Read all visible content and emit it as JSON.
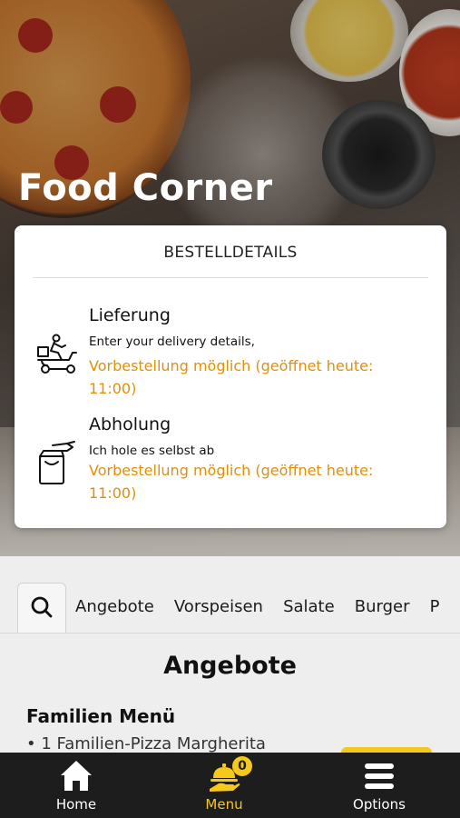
{
  "brand": {
    "title": "Food Corner"
  },
  "order_card": {
    "title": "BESTELLDETAILS",
    "options": [
      {
        "icon": "delivery-scooter-icon",
        "heading": "Lieferung",
        "subtitle": "Enter your delivery details,",
        "note": "Vorbestellung möglich (geöffnet heute: 11:00)"
      },
      {
        "icon": "takeaway-bag-icon",
        "heading": "Abholung",
        "subtitle": "Ich hole es selbst ab",
        "note": "Vorbestellung möglich (geöffnet heute: 11:00)"
      }
    ],
    "note_color": "#e0900a"
  },
  "categories": {
    "search_icon": "search-icon",
    "items": [
      "Angebote",
      "Vorspeisen",
      "Salate",
      "Burger",
      "P"
    ]
  },
  "menu": {
    "section_title": "Angebote",
    "items": [
      {
        "title": "Familien Menü",
        "description": "• 1 Familien-Pizza Margherita"
      }
    ]
  },
  "bottom_nav": {
    "items": [
      {
        "label": "Home",
        "icon": "home-icon"
      },
      {
        "label": "Menu",
        "icon": "food-serving-icon",
        "badge": "0"
      },
      {
        "label": "Options",
        "icon": "hamburger-menu-icon"
      }
    ],
    "active_color": "#f6c81b"
  }
}
